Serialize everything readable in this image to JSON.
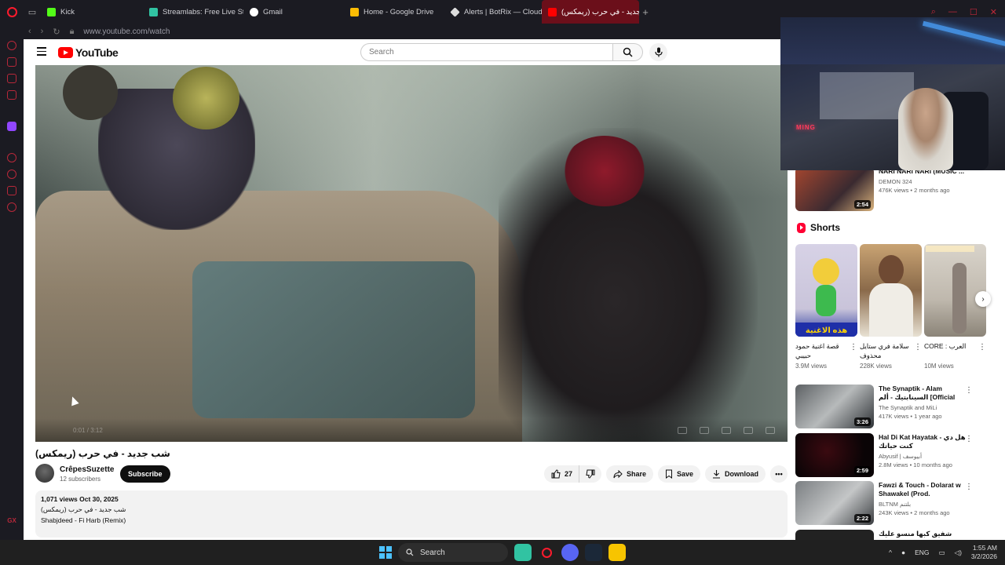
{
  "browser": {
    "tabs": [
      {
        "label": "Kick",
        "color": "#53fc18"
      },
      {
        "label": "Streamlabs: Free Live Stre",
        "color": "#31c3a2"
      },
      {
        "label": "Gmail",
        "color": "#ffffff"
      },
      {
        "label": "Home - Google Drive",
        "color": "#fbbc04"
      },
      {
        "label": "Alerts | BotRix — Cloud St",
        "color": "#dddddd"
      },
      {
        "label": "شب جديد - في حرب (ريمكس)",
        "color": "#ff0000",
        "active": true
      }
    ],
    "url": "www.youtube.com/watch",
    "sidebar_bottom": "GX"
  },
  "youtube": {
    "logo": "YouTube",
    "search_placeholder": "Search",
    "video": {
      "title": "شب جديد - في حرب (ريمكس)",
      "time": "0:01 / 3:12"
    },
    "channel": {
      "name": "CrêpesSuzette",
      "subscribers": "12 subscribers",
      "subscribe_label": "Subscribe"
    },
    "actions": {
      "likes": "27",
      "share": "Share",
      "save": "Save",
      "download": "Download"
    },
    "description": {
      "stats": "1,071 views  Oct 30, 2025",
      "line1": "شب جديد - في حرب (ريمكس)",
      "line2": "Shabjdeed - Fi Harb (Remix)"
    },
    "recommended_top": {
      "title": "NARI NARI NARI (MUSIC ...",
      "channel": "DEMON 324",
      "stats": "476K views • 2 months ago",
      "duration": "2:54"
    },
    "shorts": {
      "heading": "Shorts",
      "items": [
        {
          "title": "قصة اغنية حمود حبيبي",
          "views": "3.9M views",
          "overlay": "هذه الاغنية"
        },
        {
          "title": "سلامة فري ستايل محذوف",
          "views": "228K views"
        },
        {
          "title": "CORE : العرب",
          "views": "10M views"
        }
      ]
    },
    "recommended": [
      {
        "title": "The Synaptik - Alam السينابتيك - ألم [Official Video]",
        "channel": "The Synaptik  and MiLi",
        "stats": "417K views • 1 year ago",
        "duration": "3:26"
      },
      {
        "title": "Hal Di Kat Hayatak - هل دي كنت حياتك",
        "channel": "Abyusif | أبيوسف",
        "stats": "2.8M views • 10 months ago",
        "duration": "2:59"
      },
      {
        "title": "Fawzi & Touch - Dolarat w Shawakel (Prod. SMOKAHOLI...",
        "channel": "BLTNM بلتنم",
        "stats": "243K views • 2 months ago",
        "duration": "2:22"
      },
      {
        "title": "شفيق كبها منسو عليك",
        "channel": "",
        "stats": "",
        "duration": ""
      }
    ]
  },
  "webcam": {
    "neon_text": "MING"
  },
  "taskbar": {
    "search_label": "Search",
    "language": "ENG",
    "time": "1:55 AM",
    "date": "3/2/2026"
  },
  "colors": {
    "opera_red": "#ff1b2d",
    "youtube_red": "#ff0000",
    "active_tab": "#6b0f1a"
  }
}
